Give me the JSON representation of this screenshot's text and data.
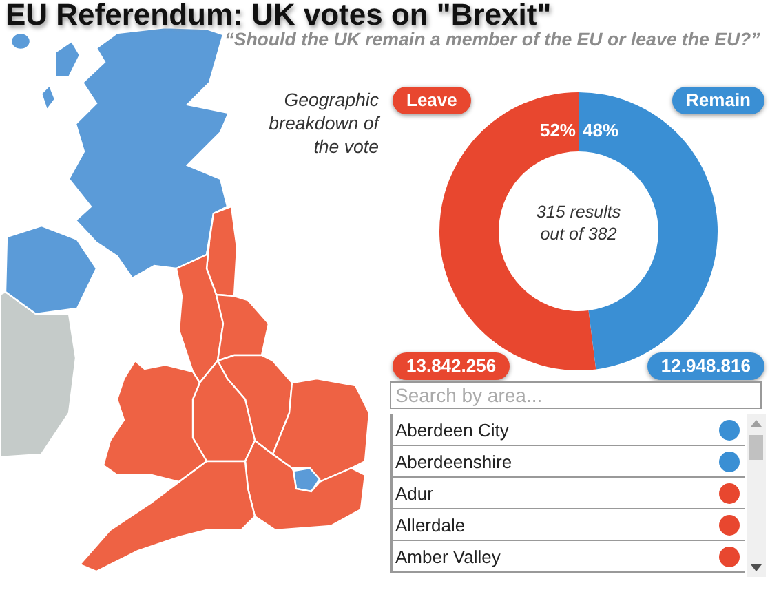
{
  "title": "EU Referendum: UK votes on \"Brexit\"",
  "question": "“Should the UK remain a member of the EU or leave the EU?”",
  "map": {
    "regions": [
      {
        "color": "#5b9bd8"
      },
      {
        "color": "#5b9bd8"
      },
      {
        "color": "#ee6244"
      },
      {
        "color": "#ee6244"
      },
      {
        "color": "#ee6244"
      },
      {
        "color": "#ee6244"
      },
      {
        "color": "#ee6244"
      },
      {
        "color": "#ee6244"
      },
      {
        "color": "#ee6244"
      },
      {
        "color": "#5b9bd8"
      },
      {
        "color": "#ee6244"
      },
      {
        "color": "#ee6244"
      }
    ]
  },
  "caption": "Geographic breakdown of the vote",
  "results": {
    "leave_total": "13.842.256",
    "remain_total": "12.948.816",
    "center_text": "315 results out of 382",
    "chart_data": {
      "type": "donut",
      "categories": [
        "Leave",
        "Remain"
      ],
      "series": [
        {
          "values": [
            52,
            48
          ]
        }
      ],
      "value_labels": [
        "52%",
        "48%"
      ]
    }
  },
  "search": {
    "placeholder": "Search by area..."
  },
  "areas": [
    {
      "name": "Aberdeen City",
      "color": "#3a8fd4"
    },
    {
      "name": "Aberdeenshire",
      "color": "#3a8fd4"
    },
    {
      "name": "Adur",
      "color": "#e8472f"
    },
    {
      "name": "Allerdale",
      "color": "#e8472f"
    },
    {
      "name": "Amber Valley",
      "color": "#e8472f"
    }
  ]
}
